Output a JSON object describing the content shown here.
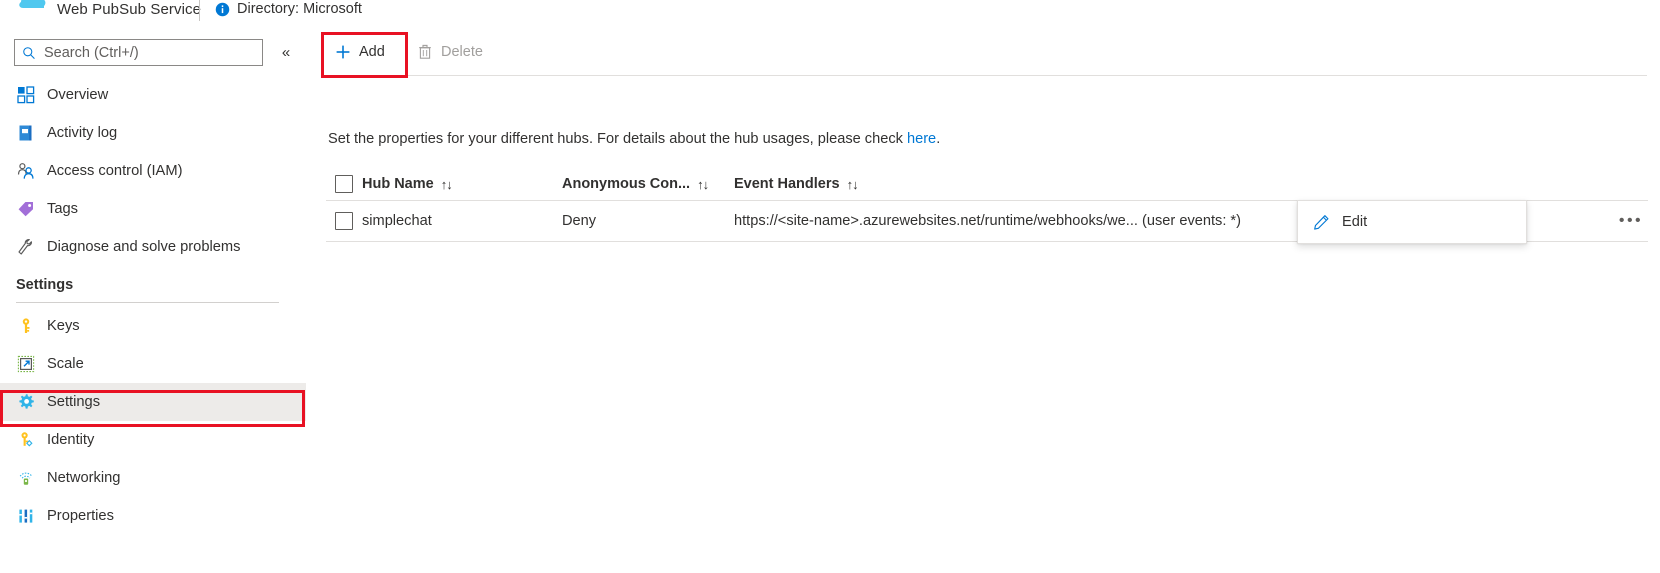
{
  "header": {
    "logo_icon": "web-pubsub-cloud-logo",
    "resource_type": "Web PubSub Service",
    "info_icon": "info-icon",
    "directory": "Directory: Microsoft"
  },
  "sidebar": {
    "search": {
      "placeholder": "Search (Ctrl+/)",
      "value": "",
      "icon": "search-icon"
    },
    "collapse_icon": "«",
    "items": [
      {
        "label": "Overview",
        "icon": "overview-icon"
      },
      {
        "label": "Activity log",
        "icon": "activity-log-icon"
      },
      {
        "label": "Access control (IAM)",
        "icon": "access-control-icon"
      },
      {
        "label": "Tags",
        "icon": "tags-icon"
      },
      {
        "label": "Diagnose and solve problems",
        "icon": "wrench-icon"
      }
    ],
    "group": {
      "title": "Settings",
      "items": [
        {
          "label": "Keys",
          "icon": "key-icon",
          "selected": false
        },
        {
          "label": "Scale",
          "icon": "scale-icon",
          "selected": false
        },
        {
          "label": "Settings",
          "icon": "gear-icon",
          "selected": true
        },
        {
          "label": "Identity",
          "icon": "identity-key-icon",
          "selected": false
        },
        {
          "label": "Networking",
          "icon": "networking-icon",
          "selected": false
        },
        {
          "label": "Properties",
          "icon": "properties-icon",
          "selected": false
        }
      ]
    }
  },
  "toolbar": {
    "add_label": "Add",
    "add_icon": "plus-icon",
    "delete_label": "Delete",
    "delete_icon": "trash-icon",
    "delete_disabled": true
  },
  "main": {
    "description_prefix": "Set the properties for your different hubs. For details about the hub usages, please check ",
    "description_link": "here",
    "description_suffix": ".",
    "table": {
      "select_all_checked": false,
      "columns": [
        {
          "label": "Hub Name",
          "sort_icon": "↑↓"
        },
        {
          "label": "Anonymous Con...",
          "sort_icon": "↑↓"
        },
        {
          "label": "Event Handlers",
          "sort_icon": "↑↓"
        }
      ],
      "rows": [
        {
          "checked": false,
          "hub_name": "simplechat",
          "anonymous_connect": "Deny",
          "event_handlers": "https://<site-name>.azurewebsites.net/runtime/webhooks/we... (user events: *)",
          "more_icon": "ellipsis-icon"
        }
      ]
    }
  },
  "context_menu": {
    "items": [
      {
        "label": "Edit",
        "icon": "pencil-icon"
      }
    ]
  },
  "highlights": {
    "color": "#e81123",
    "targets": [
      "add-button",
      "sidebar-item-settings"
    ]
  }
}
